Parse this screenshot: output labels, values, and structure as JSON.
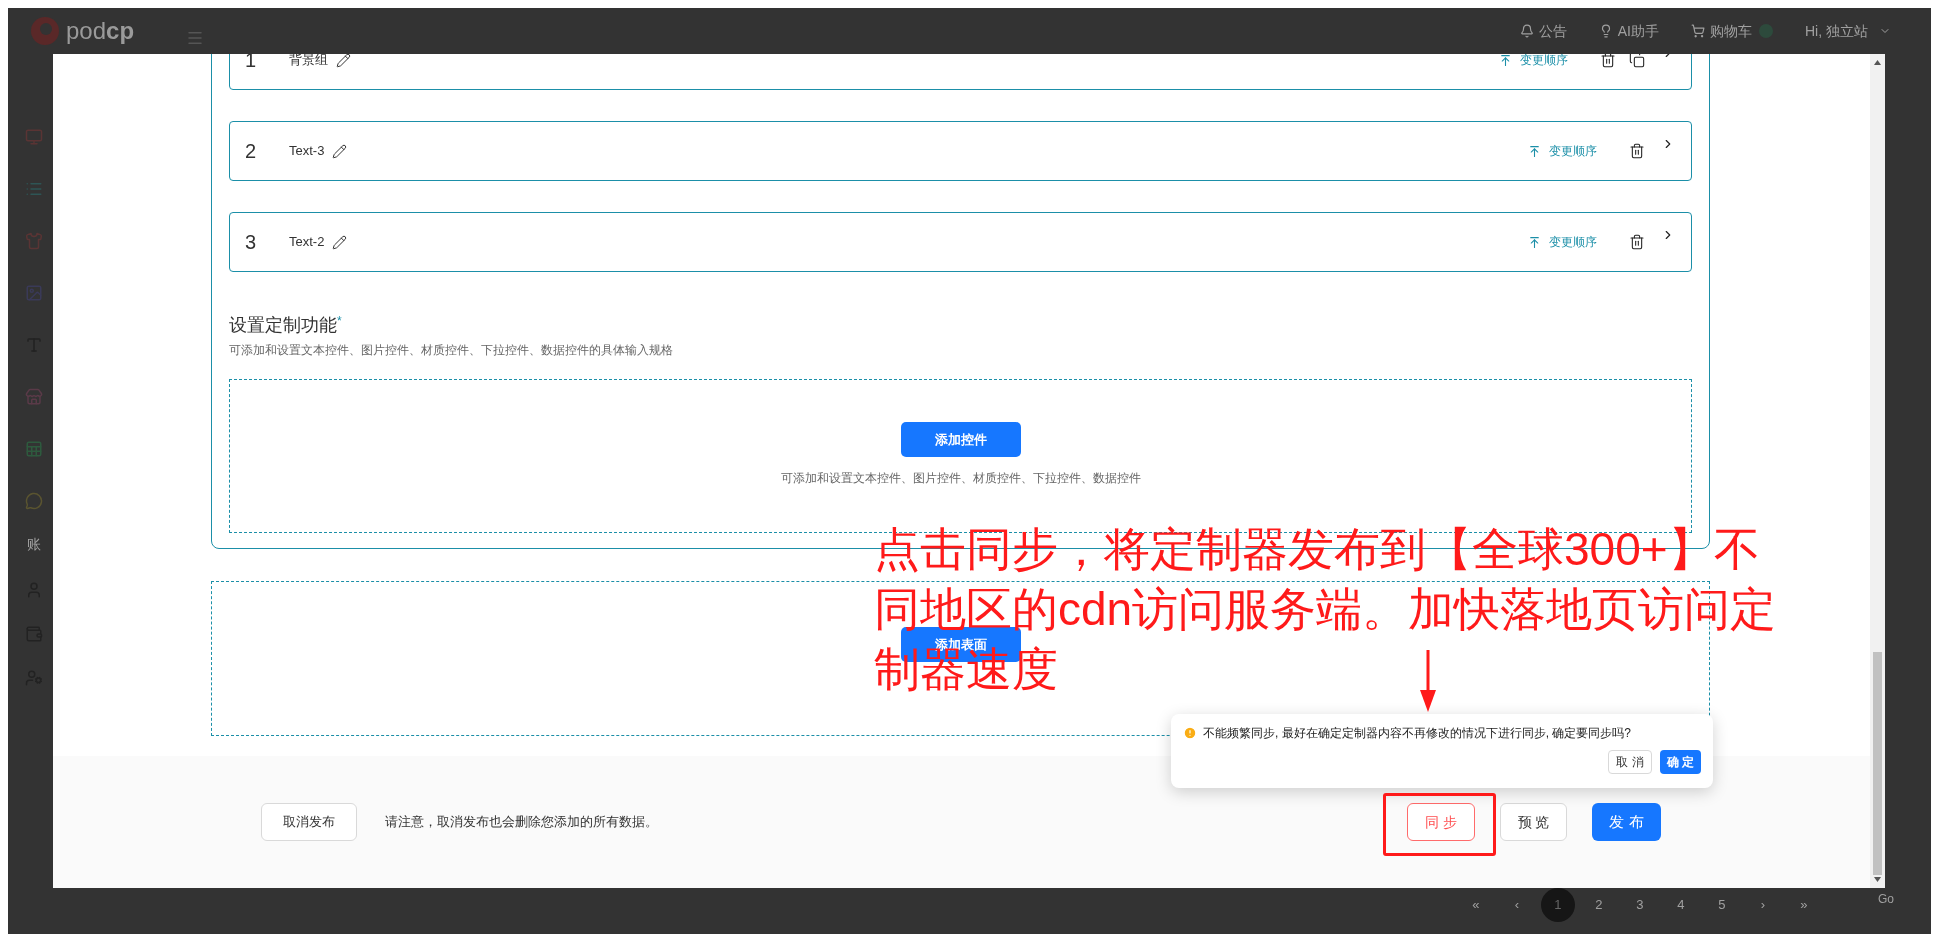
{
  "header": {
    "logo": "pod**cp**",
    "items": [
      {
        "kind": "bell",
        "label": "公告"
      },
      {
        "kind": "bulb",
        "label": "AI助手"
      },
      {
        "kind": "cart",
        "label": "购物车"
      },
      {
        "kind": "user",
        "label": "Hi, 独立站"
      }
    ]
  },
  "sidebar": {
    "section_label": "账"
  },
  "pagination": {
    "first": "«",
    "prev": "‹",
    "pages": [
      {
        "label": "1",
        "selected": true
      },
      {
        "label": "2",
        "selected": false
      },
      {
        "label": "3",
        "selected": false
      },
      {
        "label": "4",
        "selected": false
      },
      {
        "label": "5",
        "selected": false
      }
    ],
    "next": "›",
    "last": "»",
    "go": "Go"
  },
  "dialog": {
    "layers": [
      {
        "index": "1",
        "name": "背景组",
        "reorder": "变更顺序",
        "copyable": true
      },
      {
        "index": "2",
        "name": "Text-3",
        "reorder": "变更顺序",
        "copyable": false
      },
      {
        "index": "3",
        "name": "Text-2",
        "reorder": "变更顺序",
        "copyable": false
      }
    ],
    "custom_section": {
      "title": "设置定制功能",
      "required_mark": "*",
      "description": "可添加和设置文本控件、图片控件、材质控件、下拉控件、数据控件的具体输入规格",
      "add_button": "添加控件",
      "hint": "可添加和设置文本控件、图片控件、材质控件、下拉控件、数据控件"
    },
    "surface_section": {
      "add_button": "添加表面"
    },
    "footer": {
      "cancel_publish": "取消发布",
      "notice": "请注意，取消发布也会删除您添加的所有数据。",
      "sync": "同 步",
      "preview": "预 览",
      "publish": "发 布"
    },
    "popconfirm": {
      "message": "不能频繁同步, 最好在确定定制器内容不再修改的情况下进行同步, 确定要同步吗?",
      "cancel": "取 消",
      "ok": "确 定"
    }
  },
  "annotation": {
    "lines": [
      "点击同步，将定制器发布到【全球300+】不",
      "同地区的cdn访问服务端。加快落地页访问定",
      "制器速度"
    ]
  }
}
